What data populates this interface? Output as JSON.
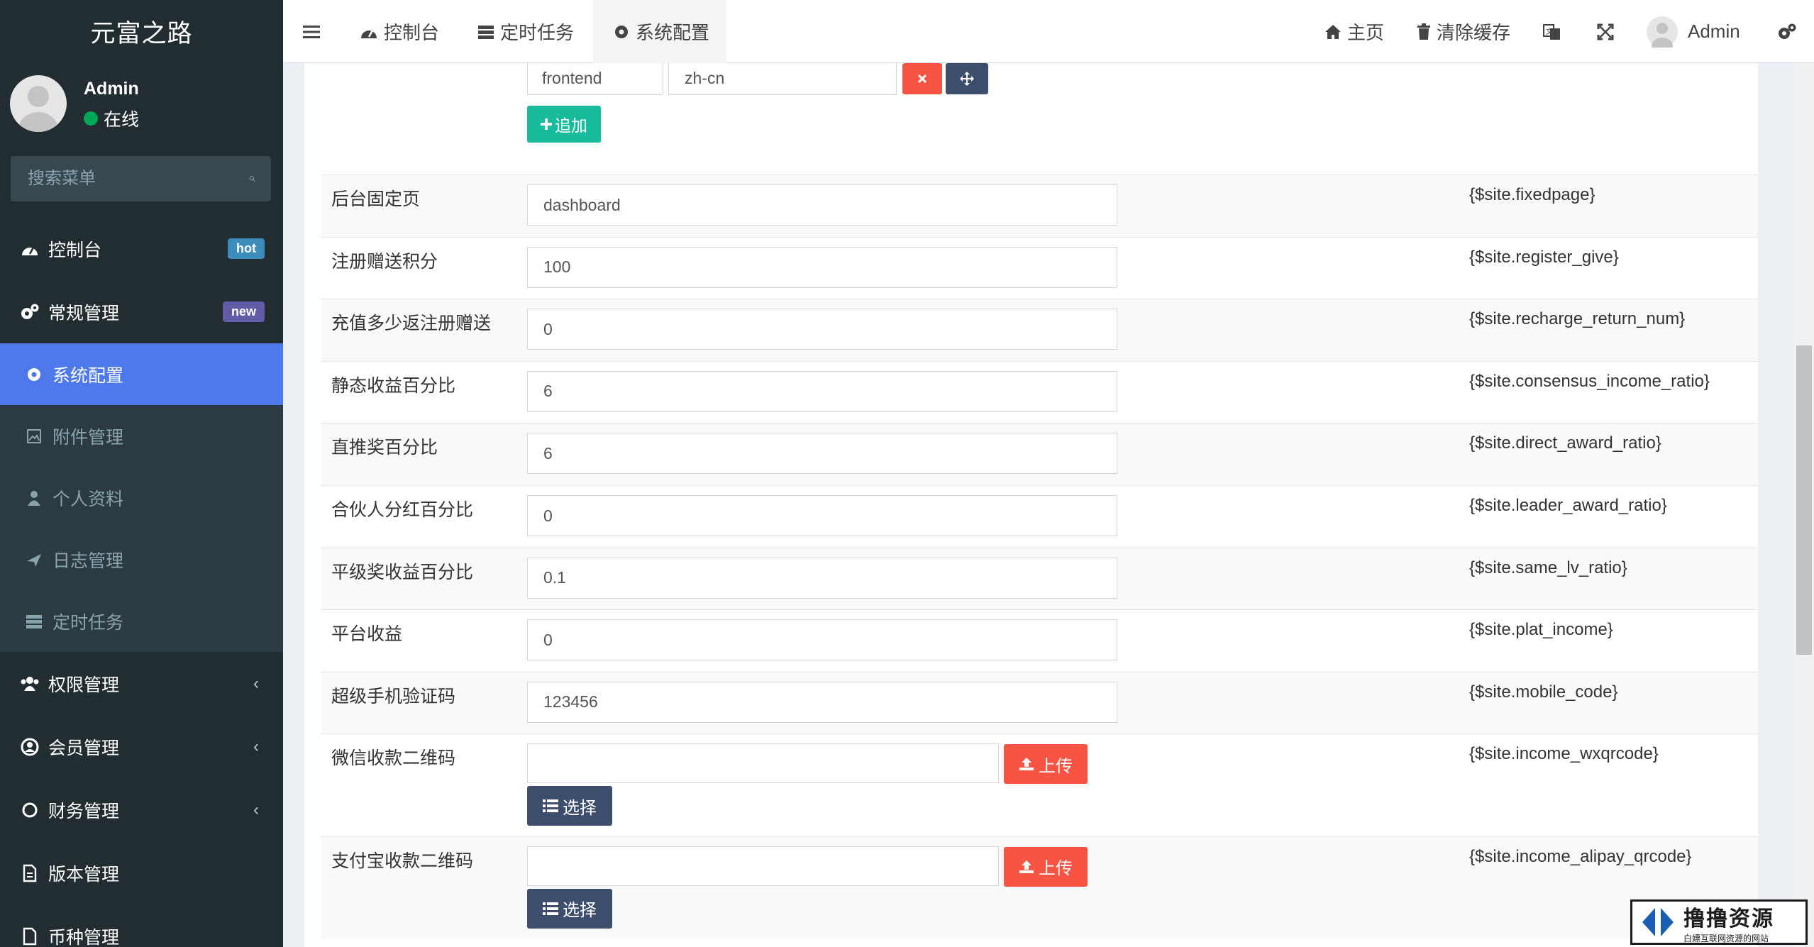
{
  "sidebar": {
    "logo": "元富之路",
    "user": {
      "name": "Admin",
      "status": "在线"
    },
    "search_placeholder": "搜索菜单",
    "items": [
      {
        "label": "控制台",
        "icon": "dashboard-icon",
        "badge": "hot",
        "badge_color": "#3c8dbc"
      },
      {
        "label": "常规管理",
        "icon": "cogs-icon",
        "badge": "new",
        "badge_color": "#605ca8"
      }
    ],
    "sub_items": [
      {
        "label": "系统配置",
        "icon": "gear-icon",
        "active": true
      },
      {
        "label": "附件管理",
        "icon": "image-icon"
      },
      {
        "label": "个人资料",
        "icon": "user-icon"
      },
      {
        "label": "日志管理",
        "icon": "plane-icon"
      },
      {
        "label": "定时任务",
        "icon": "tasks-icon"
      }
    ],
    "groups": [
      {
        "label": "权限管理",
        "icon": "users-icon",
        "chevron": "‹"
      },
      {
        "label": "会员管理",
        "icon": "user-circle-icon",
        "chevron": "‹"
      },
      {
        "label": "财务管理",
        "icon": "circle-icon",
        "chevron": "‹"
      },
      {
        "label": "版本管理",
        "icon": "file-icon"
      },
      {
        "label": "币种管理",
        "icon": "file-icon"
      }
    ]
  },
  "topbar": {
    "tabs": [
      {
        "label": "控制台",
        "icon": "dashboard-icon"
      },
      {
        "label": "定时任务",
        "icon": "tasks-icon"
      },
      {
        "label": "系统配置",
        "icon": "gear-icon",
        "active": true
      }
    ],
    "home": "主页",
    "clear_cache": "清除缓存",
    "user": "Admin"
  },
  "lang_row": {
    "key": "frontend",
    "value": "zh-cn",
    "add_label": "追加"
  },
  "config_rows": [
    {
      "label": "后台固定页",
      "value": "dashboard",
      "var": "{$site.fixedpage}"
    },
    {
      "label": "注册赠送积分",
      "value": "100",
      "var": "{$site.register_give}"
    },
    {
      "label": "充值多少返注册赠送",
      "value": "0",
      "var": "{$site.recharge_return_num}"
    },
    {
      "label": "静态收益百分比",
      "value": "6",
      "var": "{$site.consensus_income_ratio}"
    },
    {
      "label": "直推奖百分比",
      "value": "6",
      "var": "{$site.direct_award_ratio}"
    },
    {
      "label": "合伙人分红百分比",
      "value": "0",
      "var": "{$site.leader_award_ratio}"
    },
    {
      "label": "平级奖收益百分比",
      "value": "0.1",
      "var": "{$site.same_lv_ratio}"
    },
    {
      "label": "平台收益",
      "value": "0",
      "var": "{$site.plat_income}"
    },
    {
      "label": "超级手机验证码",
      "value": "123456",
      "var": "{$site.mobile_code}"
    }
  ],
  "upload_rows": [
    {
      "label": "微信收款二维码",
      "var": "{$site.income_wxqrcode}",
      "upload": "上传",
      "select": "选择"
    },
    {
      "label": "支付宝收款二维码",
      "var": "{$site.income_alipay_qrcode}",
      "upload": "上传",
      "select": "选择"
    }
  ],
  "watermark": {
    "title": "撸撸资源",
    "subtitle": "白嫖互联网资源的网站"
  }
}
